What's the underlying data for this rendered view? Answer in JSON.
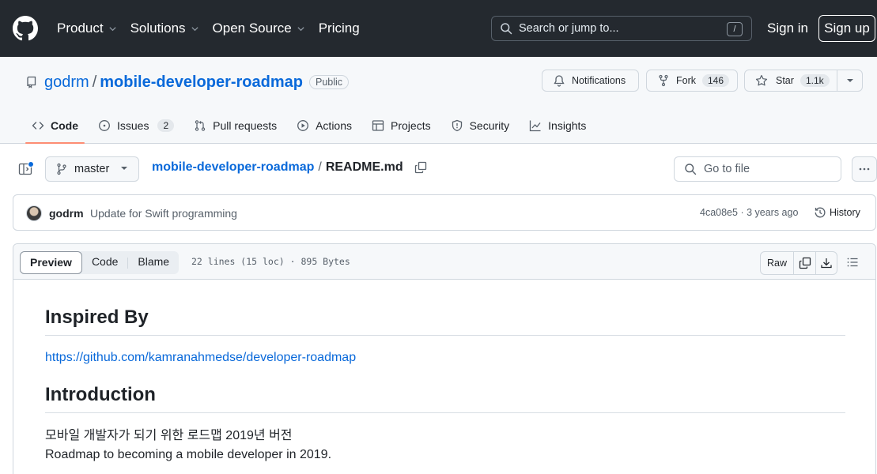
{
  "header": {
    "nav": [
      "Product",
      "Solutions",
      "Open Source",
      "Pricing"
    ],
    "search_placeholder": "Search or jump to...",
    "search_shortcut": "/",
    "sign_in": "Sign in",
    "sign_up": "Sign up"
  },
  "repo": {
    "owner": "godrm",
    "separator": "/",
    "name": "mobile-developer-roadmap",
    "visibility": "Public",
    "notifications_label": "Notifications",
    "fork_label": "Fork",
    "fork_count": "146",
    "star_label": "Star",
    "star_count": "1.1k"
  },
  "tabs": [
    {
      "label": "Code",
      "icon": "code-icon",
      "active": true
    },
    {
      "label": "Issues",
      "icon": "issue-opened-icon",
      "count": "2"
    },
    {
      "label": "Pull requests",
      "icon": "git-pull-request-icon"
    },
    {
      "label": "Actions",
      "icon": "play-icon"
    },
    {
      "label": "Projects",
      "icon": "table-icon"
    },
    {
      "label": "Security",
      "icon": "shield-icon"
    },
    {
      "label": "Insights",
      "icon": "graph-icon"
    }
  ],
  "file_nav": {
    "branch": "master",
    "breadcrumb_repo": "mobile-developer-roadmap",
    "breadcrumb_sep": "/",
    "breadcrumb_file": "README.md",
    "goto_placeholder": "Go to file"
  },
  "commit": {
    "author": "godrm",
    "message": "Update for Swift programming",
    "sha": "4ca08e5",
    "age": " · 3 years ago",
    "history_label": "History"
  },
  "viewer": {
    "modes": [
      "Preview",
      "Code",
      "Blame"
    ],
    "active_mode": "Preview",
    "file_info": "22 lines (15 loc) · 895 Bytes",
    "raw_label": "Raw"
  },
  "readme": {
    "heading1": "Inspired By",
    "link": "https://github.com/kamranahmedse/developer-roadmap",
    "heading2": "Introduction",
    "line1": "모바일 개발자가 되기 위한 로드맵 2019년 버전",
    "line2": "Roadmap to becoming a mobile developer in 2019."
  },
  "colors": {
    "header_bg": "#24292f",
    "link": "#0969da",
    "active_tab_underline": "#fd8c73"
  }
}
